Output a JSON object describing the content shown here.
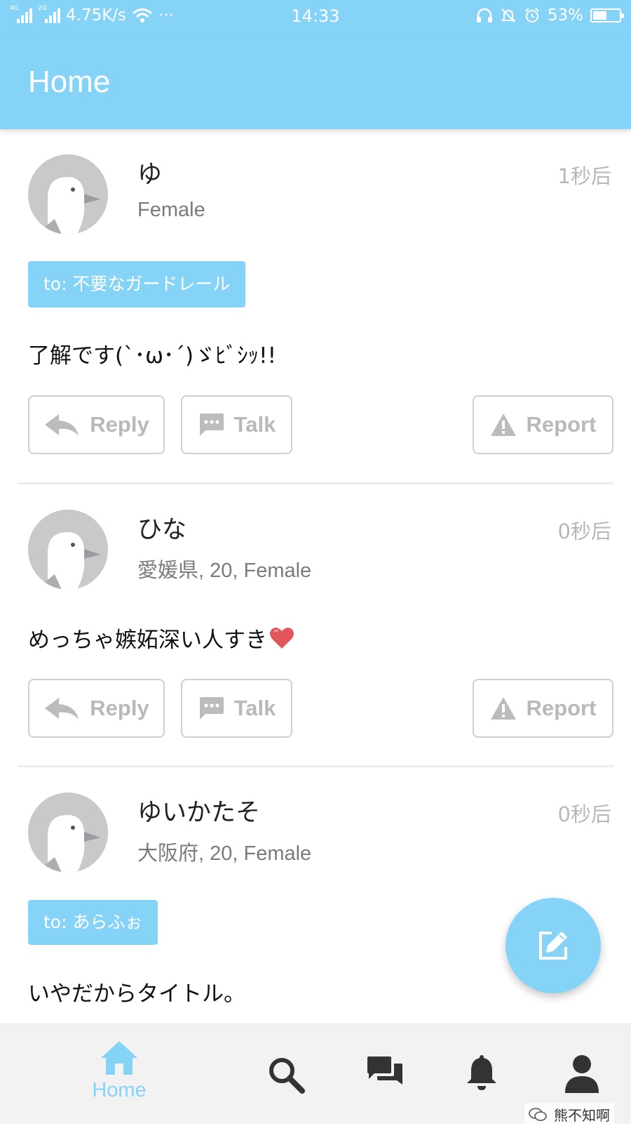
{
  "status_bar": {
    "signal_1_label": "4G",
    "signal_2_label": "2G",
    "net_speed": "4.75K/s",
    "more": "···",
    "time": "14:33",
    "battery_percent": "53%",
    "battery_level": 0.53,
    "icons": [
      "headset-icon",
      "bell-off-icon",
      "alarm-icon"
    ]
  },
  "header": {
    "title": "Home"
  },
  "posts": [
    {
      "name": "ゆ",
      "meta": "Female",
      "time": "1秒后",
      "to": "to: 不要なガードレール",
      "message": "了解です(`･ω･´)ゞﾋﾞｼｯ!!",
      "actions": {
        "reply": "Reply",
        "talk": "Talk",
        "report": "Report"
      }
    },
    {
      "name": "ひな",
      "meta": "愛媛県, 20, Female",
      "time": "0秒后",
      "message": "めっちゃ嫉妬深い人すき",
      "message_emoji": "heart-emoji",
      "actions": {
        "reply": "Reply",
        "talk": "Talk",
        "report": "Report"
      }
    },
    {
      "name": "ゆいかたそ",
      "meta": "大阪府, 20, Female",
      "time": "0秒后",
      "to": "to: あらふぉ",
      "message": "いやだからタイトル。"
    }
  ],
  "fab": {
    "icon": "compose-icon"
  },
  "bottom_nav": {
    "items": [
      {
        "icon": "home-icon",
        "label": "Home",
        "active": true
      },
      {
        "icon": "search-icon"
      },
      {
        "icon": "chat-icon"
      },
      {
        "icon": "bell-icon"
      },
      {
        "icon": "profile-icon"
      }
    ]
  },
  "watermark": {
    "text": "熊不知啊"
  },
  "colors": {
    "accent": "#86d3f8",
    "muted": "#b9b9b9",
    "background": "#ffffff"
  }
}
